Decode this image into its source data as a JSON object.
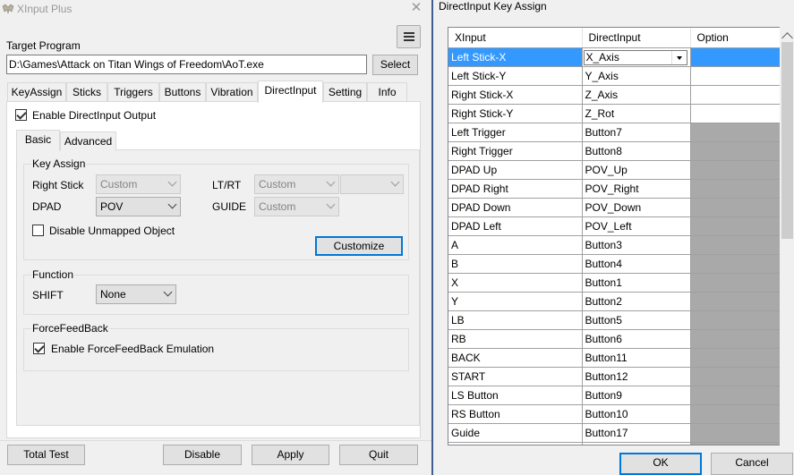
{
  "main_window": {
    "title": "XInput Plus",
    "close_glyph": "✕",
    "target_label": "Target Program",
    "target_path": "D:\\Games\\Attack on Titan Wings of Freedom\\AoT.exe",
    "select_label": "Select",
    "tabs": [
      {
        "label": "KeyAssign"
      },
      {
        "label": "Sticks"
      },
      {
        "label": "Triggers"
      },
      {
        "label": "Buttons"
      },
      {
        "label": "Vibration"
      },
      {
        "label": "DirectInput",
        "active": true
      },
      {
        "label": "Setting"
      },
      {
        "label": "Info"
      }
    ],
    "enable_output_label": "Enable DirectInput Output",
    "enable_output_checked": true,
    "inner_tabs": [
      {
        "label": "Basic",
        "active": true
      },
      {
        "label": "Advanced"
      }
    ],
    "key_assign": {
      "group_label": "Key Assign",
      "right_stick_label": "Right Stick",
      "right_stick_value": "Custom",
      "ltrt_label": "LT/RT",
      "ltrt_value": "Custom",
      "ltrt_second_value": "",
      "dpad_label": "DPAD",
      "dpad_value": "POV",
      "guide_label": "GUIDE",
      "guide_value": "Custom",
      "disable_unmapped_label": "Disable Unmapped Object",
      "disable_unmapped_checked": false,
      "customize_label": "Customize"
    },
    "function": {
      "group_label": "Function",
      "shift_label": "SHIFT",
      "shift_value": "None"
    },
    "forcefeedback": {
      "group_label": "ForceFeedBack",
      "emulation_label": "Enable ForceFeedBack Emulation",
      "emulation_checked": true
    },
    "bottom_buttons": {
      "total_test": "Total Test",
      "disable": "Disable",
      "apply": "Apply",
      "quit": "Quit"
    }
  },
  "dialog": {
    "title": "DirectInput Key Assign",
    "columns": [
      "XInput",
      "DirectInput",
      "Option"
    ],
    "rows": [
      {
        "xinput": "Left Stick-X",
        "directinput": "X_Axis",
        "selected": true
      },
      {
        "xinput": "Left Stick-Y",
        "directinput": "Y_Axis"
      },
      {
        "xinput": "Right Stick-X",
        "directinput": "Z_Axis"
      },
      {
        "xinput": "Right Stick-Y",
        "directinput": "Z_Rot"
      },
      {
        "xinput": "Left Trigger",
        "directinput": "Button7"
      },
      {
        "xinput": "Right Trigger",
        "directinput": "Button8"
      },
      {
        "xinput": "DPAD Up",
        "directinput": "POV_Up"
      },
      {
        "xinput": "DPAD Right",
        "directinput": "POV_Right"
      },
      {
        "xinput": "DPAD Down",
        "directinput": "POV_Down"
      },
      {
        "xinput": "DPAD Left",
        "directinput": "POV_Left"
      },
      {
        "xinput": "A",
        "directinput": "Button3"
      },
      {
        "xinput": "B",
        "directinput": "Button4"
      },
      {
        "xinput": "X",
        "directinput": "Button1"
      },
      {
        "xinput": "Y",
        "directinput": "Button2"
      },
      {
        "xinput": "LB",
        "directinput": "Button5"
      },
      {
        "xinput": "RB",
        "directinput": "Button6"
      },
      {
        "xinput": "BACK",
        "directinput": "Button11"
      },
      {
        "xinput": "START",
        "directinput": "Button12"
      },
      {
        "xinput": "LS Button",
        "directinput": "Button9"
      },
      {
        "xinput": "RS Button",
        "directinput": "Button10"
      },
      {
        "xinput": "Guide",
        "directinput": "Button17"
      },
      {
        "xinput": "",
        "directinput": ""
      }
    ],
    "ok_label": "OK",
    "cancel_label": "Cancel"
  },
  "colors": {
    "selection": "#3399ff",
    "focus_border": "#0078d7",
    "option_disabled": "#a9a9a9"
  }
}
